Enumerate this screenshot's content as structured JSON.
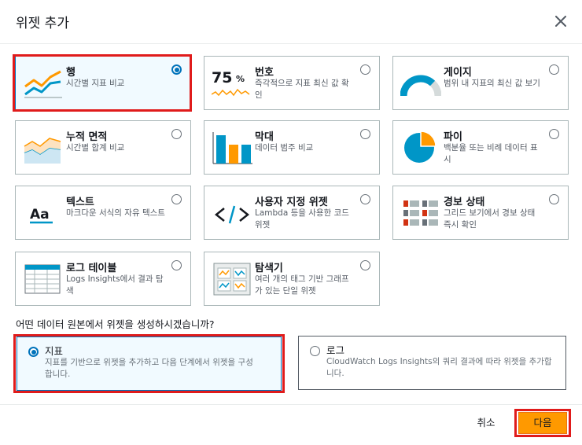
{
  "dialog": {
    "title": "위젯 추가",
    "close_icon": "close-icon"
  },
  "widget_types": [
    {
      "id": "line",
      "title": "행",
      "desc": "시간별 지표 비교",
      "icon": "line-chart-icon",
      "selected": true
    },
    {
      "id": "number",
      "title": "번호",
      "desc": "즉각적으로 지표 최신 값 확인",
      "icon": "number-icon",
      "icon_text": "75",
      "icon_unit": "%",
      "selected": false
    },
    {
      "id": "gauge",
      "title": "게이지",
      "desc": "범위 내 지표의 최신 값 보기",
      "icon": "gauge-icon",
      "selected": false
    },
    {
      "id": "stacked-area",
      "title": "누적 면적",
      "desc": "시간별 합계 비교",
      "icon": "stacked-area-icon",
      "selected": false
    },
    {
      "id": "bar",
      "title": "막대",
      "desc": "데이터 범주 비교",
      "icon": "bar-chart-icon",
      "selected": false
    },
    {
      "id": "pie",
      "title": "파이",
      "desc": "백분율 또는 비례 데이터 표시",
      "icon": "pie-chart-icon",
      "selected": false
    },
    {
      "id": "text",
      "title": "텍스트",
      "desc": "마크다운 서식의 자유 텍스트",
      "icon": "text-icon",
      "icon_text": "Aa",
      "selected": false
    },
    {
      "id": "custom",
      "title": "사용자 지정 위젯",
      "desc": "Lambda 등을 사용한 코드 위젯",
      "icon": "code-icon",
      "icon_text": "</>",
      "selected": false
    },
    {
      "id": "alarm-status",
      "title": "경보 상태",
      "desc": "그리드 보기에서 경보 상태 즉시 확인",
      "icon": "alarm-grid-icon",
      "selected": false
    },
    {
      "id": "logs-table",
      "title": "로그 테이블",
      "desc": "Logs Insights에서 결과 탐색",
      "icon": "table-icon",
      "selected": false
    },
    {
      "id": "explorer",
      "title": "탐색기",
      "desc": "여러 개의 태그 기반 그래프가 있는 단일 위젯",
      "icon": "explorer-icon",
      "selected": false
    }
  ],
  "source": {
    "question": "어떤 데이터 원본에서 위젯을 생성하시겠습니까?",
    "options": [
      {
        "id": "metrics",
        "title": "지표",
        "desc_lines": [
          "지표를 기반으로 위젯을 추가하고 다음 단계에서 위젯을 구성",
          "합니다."
        ],
        "selected": true
      },
      {
        "id": "logs",
        "title": "로그",
        "desc_lines": [
          "CloudWatch Logs Insights의 쿼리 결과에 따라 위젯을 추가합",
          "니다."
        ],
        "selected": false
      }
    ]
  },
  "footer": {
    "cancel_label": "취소",
    "next_label": "다음"
  },
  "colors": {
    "accent_blue": "#0073bb",
    "orange": "#ff9900",
    "teal": "#0096c7",
    "highlight_red": "#e01b1b"
  }
}
